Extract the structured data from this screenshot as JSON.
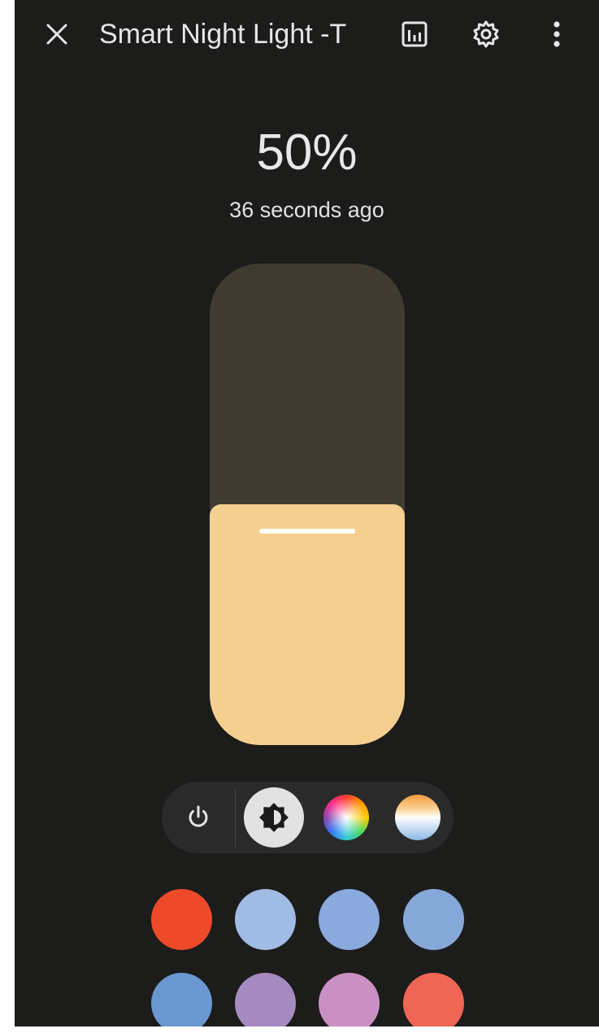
{
  "header": {
    "title": "Smart Night Light -T",
    "close_icon": "close-icon",
    "history_icon": "chart-icon",
    "settings_icon": "gear-icon",
    "menu_icon": "more-vertical-icon"
  },
  "state": {
    "brightness_label": "50%",
    "brightness_value": 0.5,
    "last_changed": "36 seconds ago"
  },
  "colors": {
    "background": "#1c1c1b",
    "slider_track": "#403b31",
    "slider_fill": "#f5cf8f"
  },
  "modes": [
    {
      "name": "power",
      "icon": "power-icon",
      "selected": false
    },
    {
      "name": "brightness",
      "icon": "brightness-icon",
      "selected": true
    },
    {
      "name": "color",
      "icon": "color-wheel-icon",
      "selected": false
    },
    {
      "name": "color-temperature",
      "icon": "color-temperature-icon",
      "selected": false
    }
  ],
  "favorite_colors": [
    "#ee4a2a",
    "#a0bce4",
    "#8aa9dd",
    "#85a8d9",
    "#6b98d1",
    "#a68bc0",
    "#ca90c4",
    "#ef6655"
  ]
}
